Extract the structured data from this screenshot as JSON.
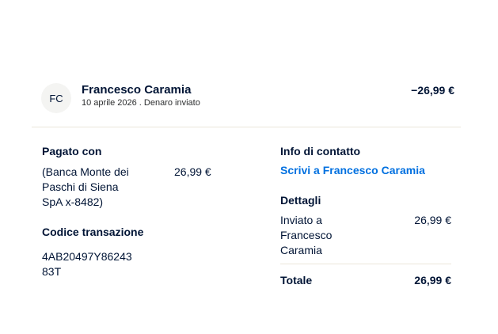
{
  "header": {
    "avatar_initials": "FC",
    "name": "Francesco Caramia",
    "date_line": "10 aprile 2026 . Denaro inviato",
    "amount": "−26,99 €"
  },
  "paid_with": {
    "title": "Pagato con",
    "source_line1": "(Banca Monte dei",
    "source_line2": "Paschi di Siena",
    "source_line3": "SpA x-8482)",
    "amount": "26,99 €"
  },
  "transaction": {
    "title": "Codice transazione",
    "code_line1": "4AB20497Y86243",
    "code_line2": "83T"
  },
  "contact": {
    "title": "Info di contatto",
    "link": "Scrivi a Francesco Caramia"
  },
  "details": {
    "title": "Dettagli",
    "sent_line1": "Inviato a",
    "sent_line2": "Francesco",
    "sent_line3": "Caramia",
    "sent_amount": "26,99 €",
    "total_label": "Totale",
    "total_amount": "26,99 €"
  },
  "colors": {
    "text": "#001435",
    "link": "#0070e0",
    "divider": "#ebe6db"
  }
}
